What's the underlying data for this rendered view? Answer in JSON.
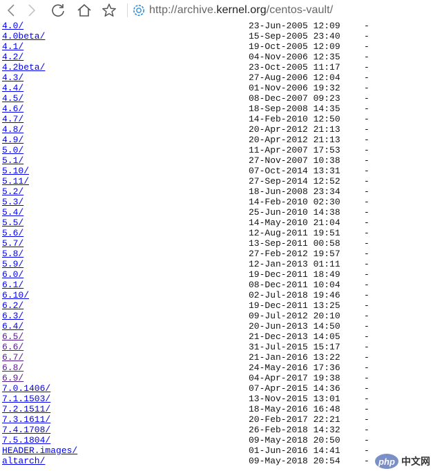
{
  "browser": {
    "url_protocol": "http://archive.",
    "url_host": "kernel.org",
    "url_path": "/centos-vault/",
    "icons": {
      "back": "back-arrow-icon",
      "forward": "forward-arrow-icon",
      "refresh": "refresh-icon",
      "home": "home-icon",
      "favorite": "star-icon",
      "site": "globe-icon"
    }
  },
  "listing": {
    "rows": [
      {
        "name": "4.0/",
        "date": "23-Jun-2005 12:09",
        "size": "-",
        "visited": false
      },
      {
        "name": "4.0beta/",
        "date": "15-Sep-2005 23:40",
        "size": "-",
        "visited": false
      },
      {
        "name": "4.1/",
        "date": "19-Oct-2005 12:09",
        "size": "-",
        "visited": false
      },
      {
        "name": "4.2/",
        "date": "04-Nov-2006 12:35",
        "size": "-",
        "visited": false
      },
      {
        "name": "4.2beta/",
        "date": "23-Oct-2005 11:17",
        "size": "-",
        "visited": false
      },
      {
        "name": "4.3/",
        "date": "27-Aug-2006 12:04",
        "size": "-",
        "visited": false
      },
      {
        "name": "4.4/",
        "date": "01-Nov-2006 19:32",
        "size": "-",
        "visited": false
      },
      {
        "name": "4.5/",
        "date": "08-Dec-2007 09:23",
        "size": "-",
        "visited": false
      },
      {
        "name": "4.6/",
        "date": "18-Sep-2008 14:35",
        "size": "-",
        "visited": false
      },
      {
        "name": "4.7/",
        "date": "14-Feb-2010 12:50",
        "size": "-",
        "visited": false
      },
      {
        "name": "4.8/",
        "date": "20-Apr-2012 21:13",
        "size": "-",
        "visited": false
      },
      {
        "name": "4.9/",
        "date": "20-Apr-2012 21:13",
        "size": "-",
        "visited": false
      },
      {
        "name": "5.0/",
        "date": "11-Apr-2007 17:53",
        "size": "-",
        "visited": false
      },
      {
        "name": "5.1/",
        "date": "27-Nov-2007 10:38",
        "size": "-",
        "visited": false
      },
      {
        "name": "5.10/",
        "date": "07-Oct-2014 13:31",
        "size": "-",
        "visited": false
      },
      {
        "name": "5.11/",
        "date": "27-Sep-2014 12:52",
        "size": "-",
        "visited": false
      },
      {
        "name": "5.2/",
        "date": "18-Jun-2008 23:34",
        "size": "-",
        "visited": false
      },
      {
        "name": "5.3/",
        "date": "14-Feb-2010 02:30",
        "size": "-",
        "visited": false
      },
      {
        "name": "5.4/",
        "date": "25-Jun-2010 14:38",
        "size": "-",
        "visited": false
      },
      {
        "name": "5.5/",
        "date": "14-May-2010 21:04",
        "size": "-",
        "visited": false
      },
      {
        "name": "5.6/",
        "date": "12-Aug-2011 19:51",
        "size": "-",
        "visited": false
      },
      {
        "name": "5.7/",
        "date": "13-Sep-2011 00:58",
        "size": "-",
        "visited": false
      },
      {
        "name": "5.8/",
        "date": "27-Feb-2012 19:57",
        "size": "-",
        "visited": false
      },
      {
        "name": "5.9/",
        "date": "12-Jan-2013 01:11",
        "size": "-",
        "visited": false
      },
      {
        "name": "6.0/",
        "date": "19-Dec-2011 18:49",
        "size": "-",
        "visited": false
      },
      {
        "name": "6.1/",
        "date": "08-Dec-2011 10:04",
        "size": "-",
        "visited": false
      },
      {
        "name": "6.10/",
        "date": "02-Jul-2018 19:46",
        "size": "-",
        "visited": false
      },
      {
        "name": "6.2/",
        "date": "19-Dec-2011 13:25",
        "size": "-",
        "visited": false
      },
      {
        "name": "6.3/",
        "date": "09-Jul-2012 20:10",
        "size": "-",
        "visited": false
      },
      {
        "name": "6.4/",
        "date": "20-Jun-2013 14:50",
        "size": "-",
        "visited": false
      },
      {
        "name": "6.5/",
        "date": "21-Dec-2013 14:05",
        "size": "-",
        "visited": true
      },
      {
        "name": "6.6/",
        "date": "31-Jul-2015 15:17",
        "size": "-",
        "visited": true
      },
      {
        "name": "6.7/",
        "date": "21-Jan-2016 13:22",
        "size": "-",
        "visited": true
      },
      {
        "name": "6.8/",
        "date": "24-May-2016 17:36",
        "size": "-",
        "visited": true
      },
      {
        "name": "6.9/",
        "date": "04-Apr-2017 19:38",
        "size": "-",
        "visited": true
      },
      {
        "name": "7.0.1406/",
        "date": "07-Apr-2015 14:36",
        "size": "-",
        "visited": false
      },
      {
        "name": "7.1.1503/",
        "date": "13-Nov-2015 13:01",
        "size": "-",
        "visited": false
      },
      {
        "name": "7.2.1511/",
        "date": "18-May-2016 16:48",
        "size": "-",
        "visited": false
      },
      {
        "name": "7.3.1611/",
        "date": "20-Feb-2017 22:21",
        "size": "-",
        "visited": false
      },
      {
        "name": "7.4.1708/",
        "date": "26-Feb-2018 14:32",
        "size": "-",
        "visited": false
      },
      {
        "name": "7.5.1804/",
        "date": "09-May-2018 20:50",
        "size": "-",
        "visited": false
      },
      {
        "name": "HEADER.images/",
        "date": "01-Jun-2016 14:41",
        "size": "-",
        "visited": false
      },
      {
        "name": "altarch/",
        "date": "09-May-2018 20:54",
        "size": "-",
        "visited": false
      }
    ]
  },
  "watermark": {
    "logo": "php",
    "text": "中文网"
  },
  "colors": {
    "link": "#0000ee",
    "visited_link": "#551a8b",
    "globe_accent": "#2f8fe0"
  }
}
